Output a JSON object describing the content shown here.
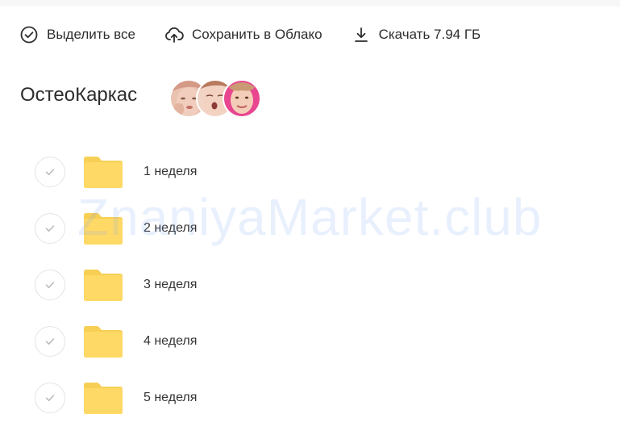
{
  "toolbar": {
    "select_all_label": "Выделить все",
    "save_cloud_label": "Сохранить в Облако",
    "download_label": "Скачать 7.94 ГБ"
  },
  "folder": {
    "title": "ОстеоКаркас",
    "avatars": [
      "avatar-1",
      "avatar-2",
      "avatar-3"
    ]
  },
  "items": [
    {
      "label": "1 неделя"
    },
    {
      "label": "2 неделя"
    },
    {
      "label": "3 неделя"
    },
    {
      "label": "4 неделя"
    },
    {
      "label": "5 неделя"
    }
  ],
  "watermark": "ZnaniyaMarket.club",
  "colors": {
    "folder": "#ffd966",
    "folder_dark": "#f7cf55",
    "text": "#2c2d2e",
    "check_border": "#e4e4e6",
    "watermark": "#a8c2f2"
  },
  "icons": {
    "select_all": "check-circle-icon",
    "save_cloud": "cloud-upload-icon",
    "download": "download-icon",
    "item": "folder-icon",
    "checkbox": "checkmark-icon"
  }
}
